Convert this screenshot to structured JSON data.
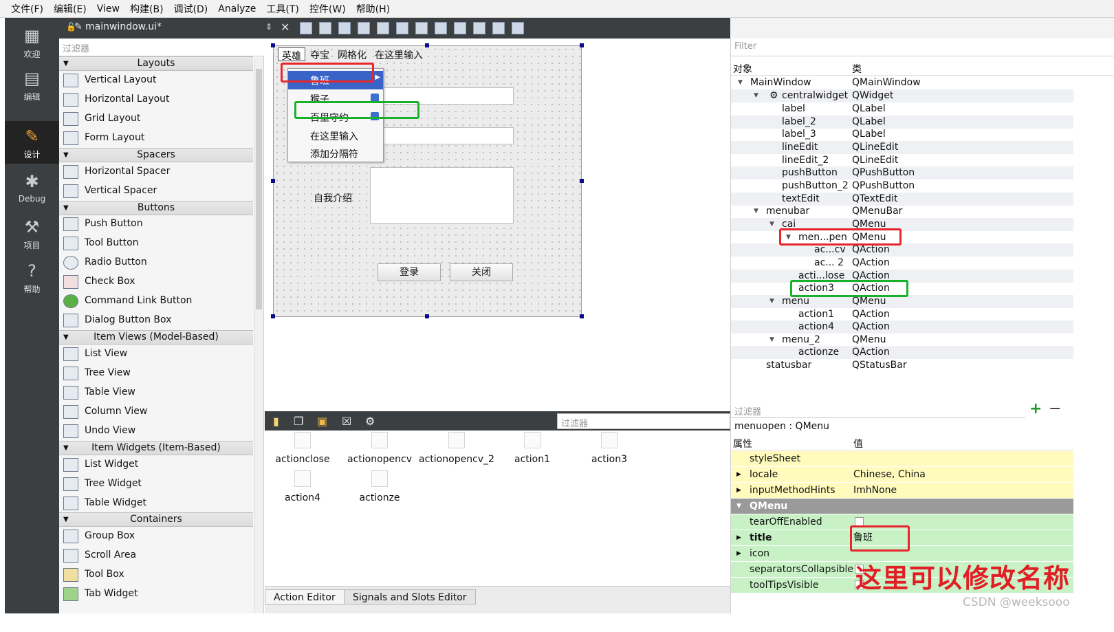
{
  "menubar": [
    "文件(F)",
    "编辑(E)",
    "View",
    "构建(B)",
    "调试(D)",
    "Analyze",
    "工具(T)",
    "控件(W)",
    "帮助(H)"
  ],
  "modes": [
    {
      "label": "欢迎",
      "icon": "grid-icon"
    },
    {
      "label": "编辑",
      "icon": "document-icon"
    },
    {
      "label": "设计",
      "icon": "pencil-icon"
    },
    {
      "label": "Debug",
      "icon": "bug-icon"
    },
    {
      "label": "项目",
      "icon": "wrench-icon"
    },
    {
      "label": "帮助",
      "icon": "help-icon"
    }
  ],
  "toolbar": {
    "file": "mainwindow.ui*"
  },
  "widget_box": {
    "filter_placeholder": "过滤器",
    "categories": [
      "Layouts",
      "Spacers",
      "Buttons",
      "Item Views (Model-Based)",
      "Item Widgets (Item-Based)",
      "Containers"
    ],
    "items": {
      "layouts": [
        "Vertical Layout",
        "Horizontal Layout",
        "Grid Layout",
        "Form Layout"
      ],
      "spacers": [
        "Horizontal Spacer",
        "Vertical Spacer"
      ],
      "buttons": [
        "Push Button",
        "Tool Button",
        "Radio Button",
        "Check Box",
        "Command Link Button",
        "Dialog Button Box"
      ],
      "item_views": [
        "List View",
        "Tree View",
        "Table View",
        "Column View",
        "Undo View"
      ],
      "item_widgets": [
        "List Widget",
        "Tree Widget",
        "Table Widget"
      ],
      "containers": [
        "Group Box",
        "Scroll Area",
        "Tool Box",
        "Tab Widget"
      ]
    }
  },
  "form": {
    "menus": [
      "英雄",
      "夺宝",
      "网格化",
      "在这里输入"
    ],
    "popup": [
      "鲁班",
      "猴子",
      "百里守约",
      "在这里输入",
      "添加分隔符"
    ],
    "label_intro": "自我介绍",
    "btn_login": "登录",
    "btn_close": "关闭"
  },
  "action_editor": {
    "filter_placeholder": "过滤器",
    "actions": [
      "actionclose",
      "actionopencv",
      "actionopencv_2",
      "action1",
      "action3",
      "action4",
      "actionze"
    ],
    "tabs": [
      "Action Editor",
      "Signals and Slots Editor"
    ]
  },
  "object_inspector": {
    "filter_placeholder": "Filter",
    "col_object": "对象",
    "col_class": "类",
    "rows": [
      {
        "name": "MainWindow",
        "cls": "QMainWindow"
      },
      {
        "name": "centralwidget",
        "cls": "QWidget"
      },
      {
        "name": "label",
        "cls": "QLabel"
      },
      {
        "name": "label_2",
        "cls": "QLabel"
      },
      {
        "name": "label_3",
        "cls": "QLabel"
      },
      {
        "name": "lineEdit",
        "cls": "QLineEdit"
      },
      {
        "name": "lineEdit_2",
        "cls": "QLineEdit"
      },
      {
        "name": "pushButton",
        "cls": "QPushButton"
      },
      {
        "name": "pushButton_2",
        "cls": "QPushButton"
      },
      {
        "name": "textEdit",
        "cls": "QTextEdit"
      },
      {
        "name": "menubar",
        "cls": "QMenuBar"
      },
      {
        "name": "cai",
        "cls": "QMenu"
      },
      {
        "name": "men...pen",
        "cls": "QMenu"
      },
      {
        "name": "ac...cv",
        "cls": "QAction"
      },
      {
        "name": "ac... 2",
        "cls": "QAction"
      },
      {
        "name": "acti...lose",
        "cls": "QAction"
      },
      {
        "name": "action3",
        "cls": "QAction"
      },
      {
        "name": "menu",
        "cls": "QMenu"
      },
      {
        "name": "action1",
        "cls": "QAction"
      },
      {
        "name": "action4",
        "cls": "QAction"
      },
      {
        "name": "menu_2",
        "cls": "QMenu"
      },
      {
        "name": "actionze",
        "cls": "QAction"
      },
      {
        "name": "statusbar",
        "cls": "QStatusBar"
      }
    ]
  },
  "property_editor": {
    "filter_placeholder": "过滤器",
    "object": "menuopen : QMenu",
    "col_prop": "属性",
    "col_value": "值",
    "rows": [
      {
        "name": "styleSheet",
        "value": ""
      },
      {
        "name": "locale",
        "value": "Chinese, China"
      },
      {
        "name": "inputMethodHints",
        "value": "ImhNone"
      },
      {
        "name": "QMenu",
        "value": ""
      },
      {
        "name": "tearOffEnabled",
        "value": ""
      },
      {
        "name": "title",
        "value": "鲁班"
      },
      {
        "name": "icon",
        "value": ""
      },
      {
        "name": "separatorsCollapsible",
        "value": ""
      },
      {
        "name": "toolTipsVisible",
        "value": ""
      }
    ]
  },
  "annotation": "这里可以修改名称",
  "watermark": "CSDN @weeksooo"
}
